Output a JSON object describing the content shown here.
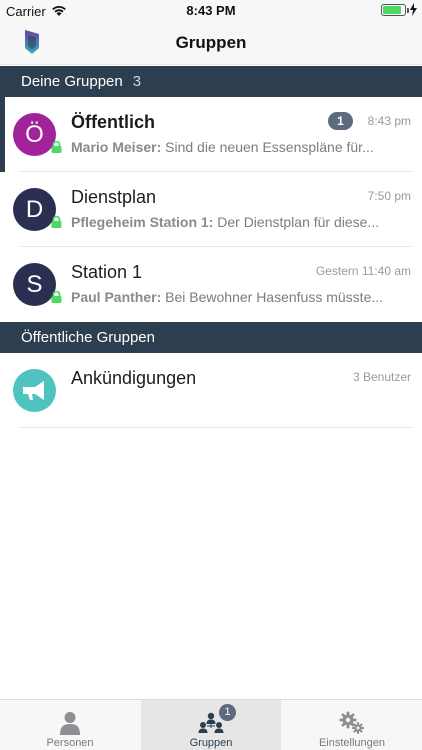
{
  "status_bar": {
    "carrier": "Carrier",
    "time": "8:43 PM",
    "battery_level": 0.85
  },
  "nav": {
    "title": "Gruppen"
  },
  "sections": {
    "my_groups": {
      "title": "Deine Gruppen",
      "count": "3"
    },
    "public_groups": {
      "title": "Öffentliche Gruppen"
    }
  },
  "my_groups": [
    {
      "avatar_letter": "Ö",
      "avatar_color": "#a1229b",
      "title": "Öffentlich",
      "time": "8:43 pm",
      "unread": "1",
      "sender": "Mario Meiser:",
      "message": " Sind die neuen Essenspläne für..."
    },
    {
      "avatar_letter": "D",
      "avatar_color": "#2b2f52",
      "title": "Dienstplan",
      "time": "7:50 pm",
      "sender": "Pflegeheim Station 1:",
      "message": " Der Dienstplan für diese..."
    },
    {
      "avatar_letter": "S",
      "avatar_color": "#2b2f52",
      "title": "Station 1",
      "time": "Gestern 11:40 am",
      "sender": "Paul Panther:",
      "message": " Bei Bewohner Hasenfuss müsste..."
    }
  ],
  "public_groups": [
    {
      "icon": "megaphone-icon",
      "avatar_color": "#4fc3c0",
      "title": "Ankündigungen",
      "member_count": "3 Benutzer"
    }
  ],
  "tab_bar": {
    "tabs": [
      {
        "label": "Personen",
        "icon": "person-icon"
      },
      {
        "label": "Gruppen",
        "icon": "group-icon",
        "badge": "1"
      },
      {
        "label": "Einstellungen",
        "icon": "gear-icon"
      }
    ],
    "selected": "Gruppen"
  },
  "colors": {
    "accent": "#2c3e50",
    "badge": "#5d6b7f",
    "lock": "#4cd964"
  }
}
